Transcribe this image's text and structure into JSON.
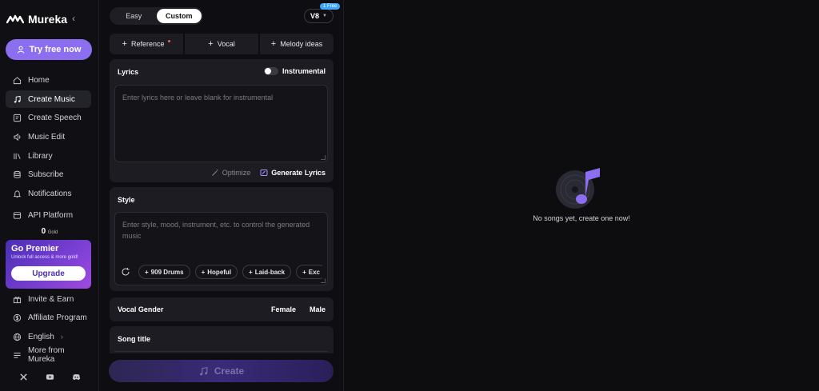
{
  "brand": {
    "name": "Mureka",
    "logo_icon": "mureka-wave-logo"
  },
  "sidebar": {
    "try_free": "Try free now",
    "items": [
      {
        "label": "Home",
        "icon": "home-icon",
        "active": false
      },
      {
        "label": "Create Music",
        "icon": "music-note-icon",
        "active": true
      },
      {
        "label": "Create Speech",
        "icon": "speech-icon",
        "active": false
      },
      {
        "label": "Music Edit",
        "icon": "sound-edit-icon",
        "active": false
      },
      {
        "label": "Library",
        "icon": "library-icon",
        "active": false
      },
      {
        "label": "Subscribe",
        "icon": "subscribe-icon",
        "active": false
      },
      {
        "label": "Notifications",
        "icon": "bell-icon",
        "active": false
      },
      {
        "label": "API Platform",
        "icon": "api-icon",
        "active": false
      }
    ],
    "gold_amount": "0",
    "gold_label": "Gold",
    "premier": {
      "title": "Go Premier",
      "subtitle": "Unlock full access & more gold!",
      "button": "Upgrade"
    },
    "bottom_items": [
      {
        "label": "Invite & Earn",
        "icon": "gift-icon"
      },
      {
        "label": "Affiliate Program",
        "icon": "dollar-icon"
      },
      {
        "label": "English",
        "icon": "globe-icon"
      },
      {
        "label": "More from Mureka",
        "icon": "menu-icon"
      }
    ],
    "socials": [
      "x-icon",
      "youtube-icon",
      "discord-icon"
    ]
  },
  "form": {
    "modes": [
      "Easy",
      "Custom"
    ],
    "active_mode": "Custom",
    "version": "V8",
    "free_badge": "1 Free",
    "refs": [
      "Reference",
      "Vocal",
      "Melody ideas"
    ],
    "lyrics": {
      "title": "Lyrics",
      "instrumental": "Instrumental",
      "placeholder": "Enter lyrics here or leave blank for instrumental",
      "optimize": "Optimize",
      "generate": "Generate Lyrics"
    },
    "style": {
      "title": "Style",
      "placeholder": "Enter style, mood, instrument, etc. to control the generated music",
      "chips": [
        "909 Drums",
        "Hopeful",
        "Laid-back",
        "Exc"
      ]
    },
    "vocal_gender": {
      "title": "Vocal Gender",
      "options": [
        "Female",
        "Male"
      ]
    },
    "song_title": "Song title",
    "create": "Create"
  },
  "main": {
    "empty_text": "No songs yet, create one now!"
  },
  "colors": {
    "accent": "#8b6ff0",
    "background": "#0e0e12",
    "card": "#1c1c22"
  }
}
